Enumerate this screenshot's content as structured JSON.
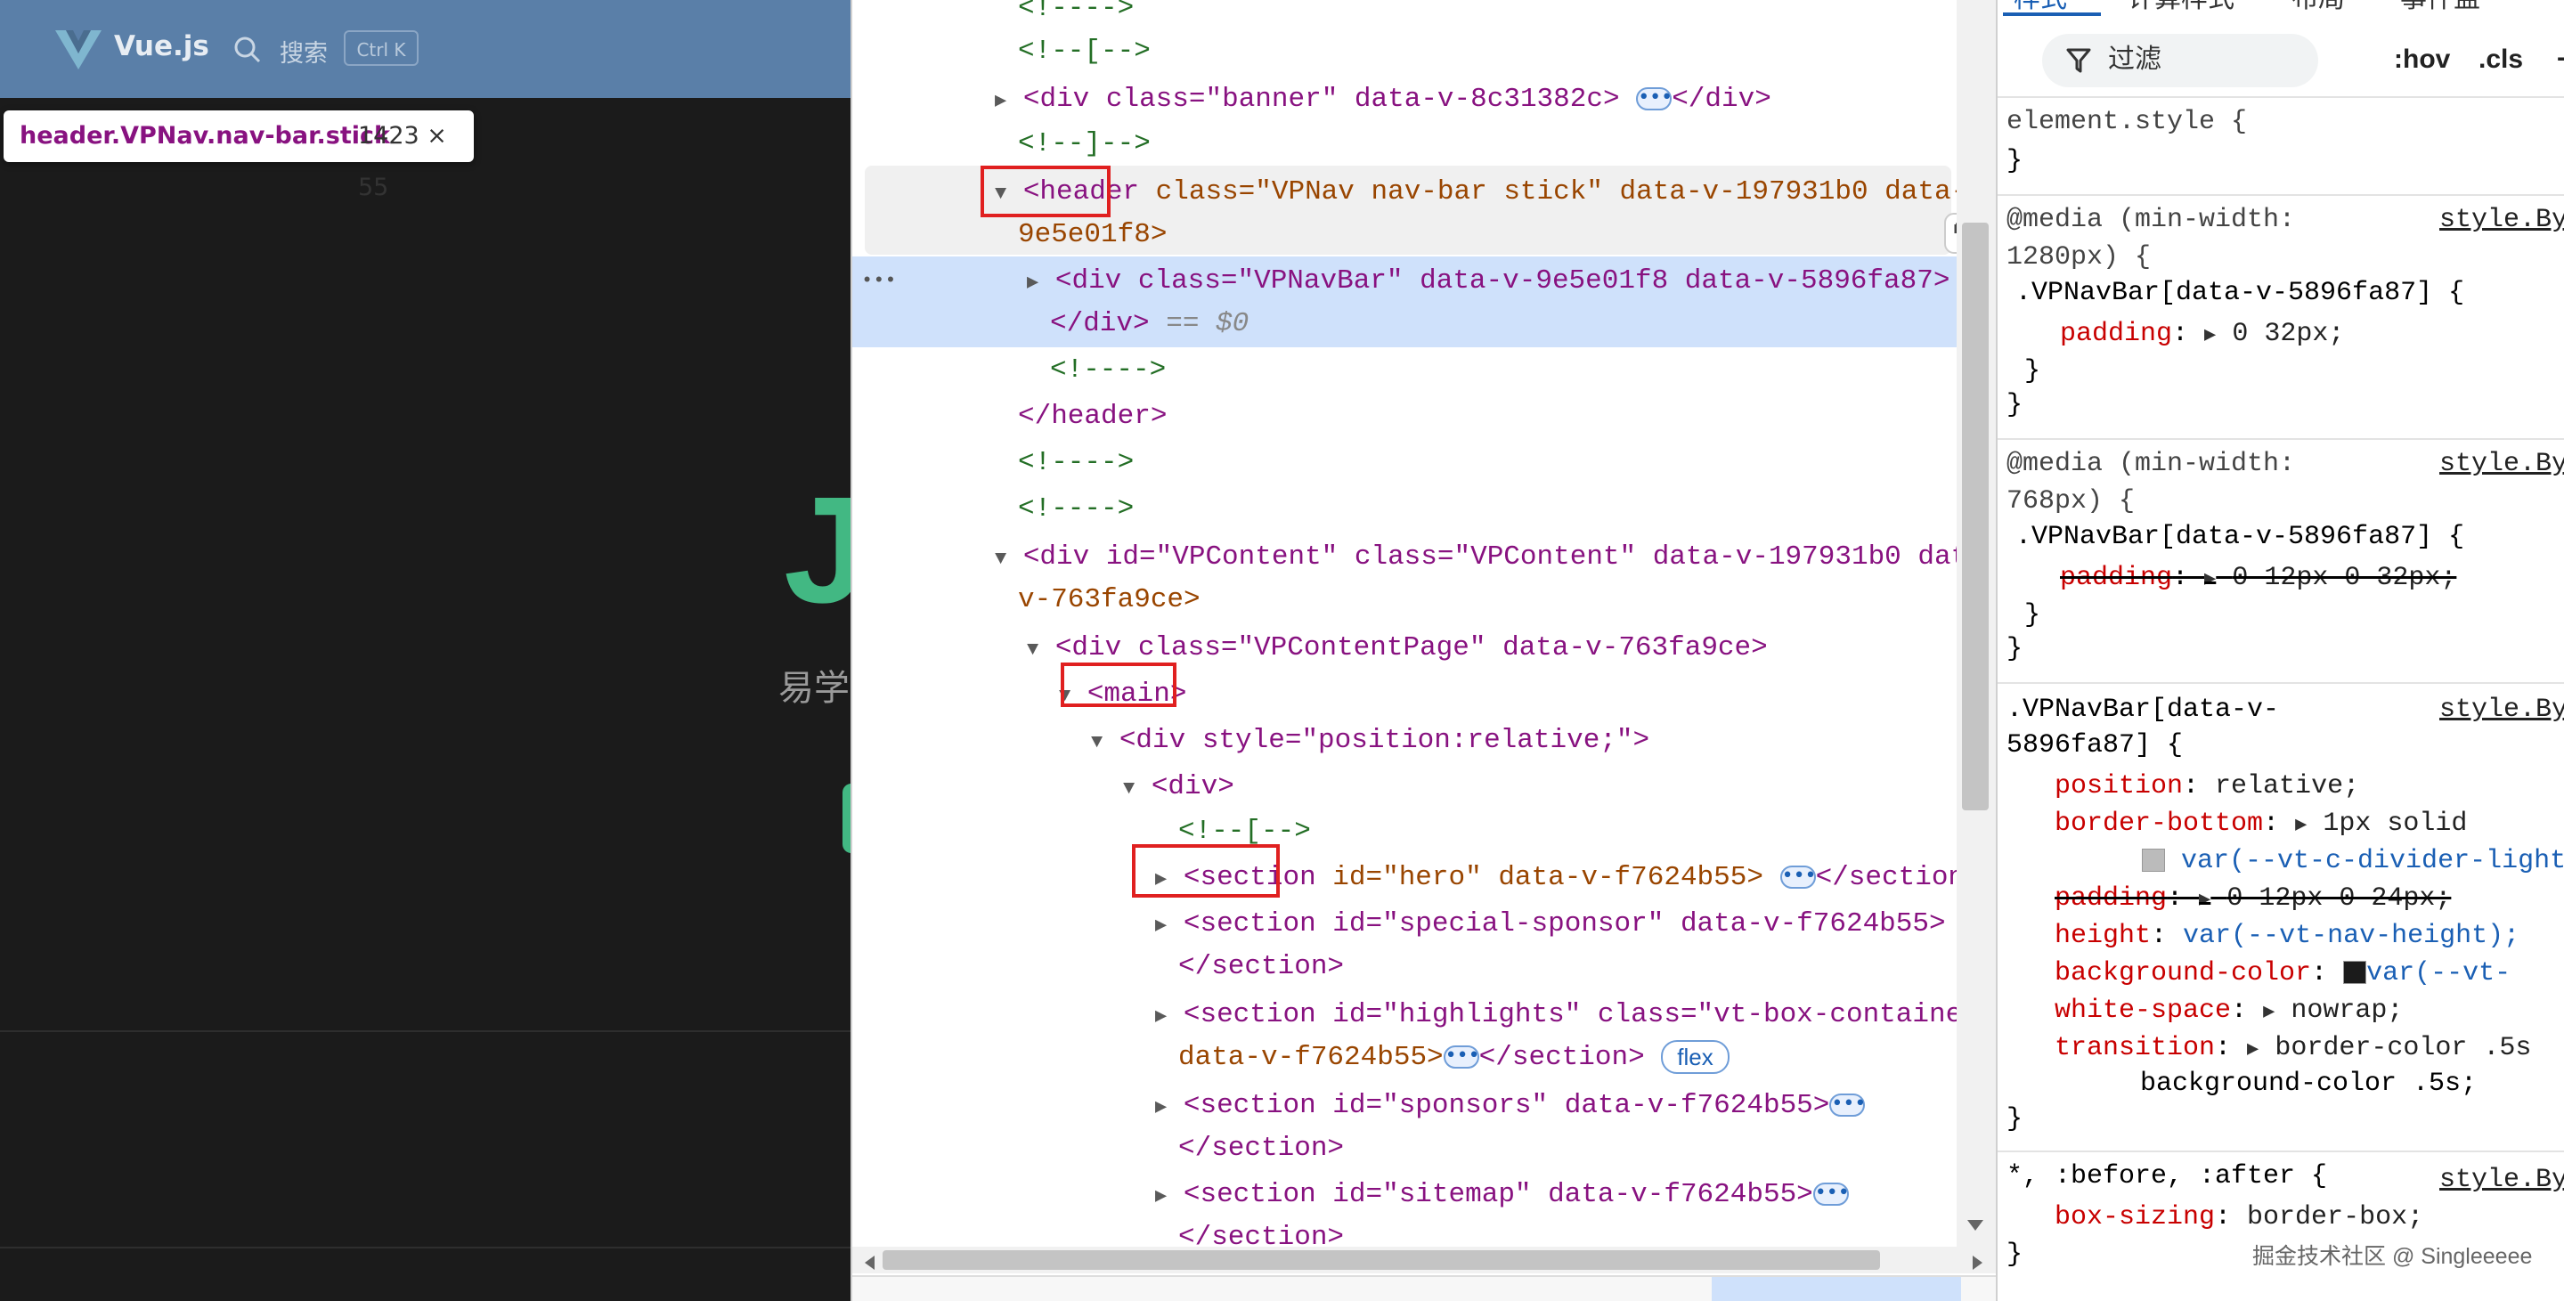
{
  "left_page": {
    "brand": "Vue.js",
    "search_label": "搜索",
    "search_shortcut": "Ctrl K",
    "tooltip_selector": "header.VPNav.nav-bar.stick",
    "tooltip_size": "1423 × 55",
    "hero_partial_title": "J",
    "hero_partial_subtitle": "易学"
  },
  "elements": {
    "lines": {
      "l0": "<!---->",
      "l1": "<!--[-->",
      "l2a": "<div class=\"banner\" data-v-8c31382c>",
      "l2b": "</div>",
      "l3": "<!--]-->",
      "l4a": "<header",
      "l4b": " class=\"VPNav nav-bar stick\" data-v-197931b0 data-v-",
      "l5": "9e5e01f8>",
      "l6a": "<div class=\"VPNavBar\" data-v-9e5e01f8 data-v-5896fa87>",
      "l7a": "</div>",
      "l7b": " == $0",
      "l8": "<!---->",
      "l9": "</header>",
      "l10": "<!---->",
      "l11": "<!---->",
      "l12": "<div id=\"VPContent\" class=\"VPContent\" data-v-197931b0 data-",
      "l13": "v-763fa9ce>",
      "l14": "<div class=\"VPContentPage\" data-v-763fa9ce>",
      "l15": "<main>",
      "l16": "<div style=\"position:relative;\">",
      "l17": "<div>",
      "l18": "<!--[-->",
      "l19a": "<section",
      "l19b": " id=\"hero\" data-v-f7624b55>",
      "l19c": "</section>",
      "l20": "<section id=\"special-sponsor\" data-v-f7624b55>",
      "l21": "</section>",
      "l22": "<section id=\"highlights\" class=\"vt-box-container\"",
      "l23a": "data-v-f7624b55>",
      "l23b": "</section>",
      "l24": "<section id=\"sponsors\" data-v-f7624b55>",
      "l25": "</section>",
      "l26": "<section id=\"sitemap\" data-v-f7624b55>",
      "l27": "</section>"
    },
    "ellipsis": "•••",
    "flex_badge": "flex",
    "gutter_dots": "•••"
  },
  "styles": {
    "tabs": [
      "样式",
      "计算样式",
      "布局",
      "事件监"
    ],
    "filter_placeholder": "过滤",
    "hov": ":hov",
    "cls": ".cls",
    "plus": "+",
    "element_style": "element.style {",
    "close_brace": "}",
    "rule1_media_a": "@media (min-width:",
    "rule1_media_b": "1280px) {",
    "rule1_src": "style.By",
    "rule1_selector": ".VPNavBar[data-v-5896fa87] {",
    "rule1_prop": "padding",
    "rule1_val": "0 32px;",
    "rule2_media_a": "@media (min-width:",
    "rule2_media_b": "768px) {",
    "rule2_src": "style.By",
    "rule2_selector": ".VPNavBar[data-v-5896fa87] {",
    "rule2_prop": "padding",
    "rule2_val": "0 12px 0 32px;",
    "rule3_selector_a": ".VPNavBar[data-v-",
    "rule3_selector_b": "5896fa87] {",
    "rule3_src": "style.By",
    "r3_pos_prop": "position",
    "r3_pos_val": "relative;",
    "r3_bb_prop": "border-bottom",
    "r3_bb_val": "1px solid",
    "r3_bb_var": "var(--vt-c-divider-light",
    "r3_pad_prop": "padding",
    "r3_pad_val": "0 12px 0 24px;",
    "r3_h_prop": "height",
    "r3_h_val": "var(--vt-nav-height);",
    "r3_bg_prop": "background-color",
    "r3_bg_val": "var(--vt-",
    "r3_ws_prop": "white-space",
    "r3_ws_val": "nowrap;",
    "r3_tr_prop": "transition",
    "r3_tr_val": "border-color .5s",
    "r3_tr_val2": "background-color .5s;",
    "rule4_selector": "*, :before, :after {",
    "rule4_src": "style.By",
    "r4_prop": "box-sizing",
    "r4_val": "border-box;",
    "watermark": "掘金技术社区 @ Singleeeee"
  },
  "colors": {
    "tag": "#881280",
    "attr": "#994500",
    "value": "#1a1aa6",
    "comment": "#236e25",
    "highlight_box": "#e02020",
    "selected_row": "#cfe1fb",
    "vue_green": "#42b883"
  }
}
